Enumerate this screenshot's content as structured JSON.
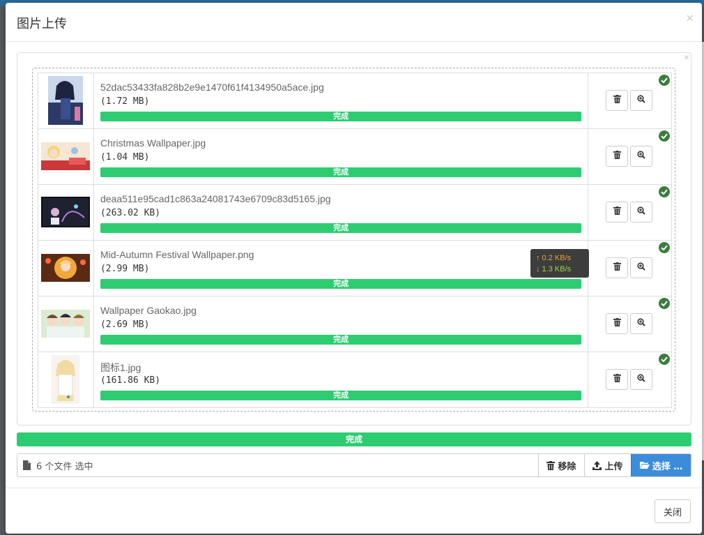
{
  "modal": {
    "title": "图片上传"
  },
  "files": [
    {
      "name": "52dac53433fa828b2e9e1470f61f4134950a5ace.jpg",
      "size": "(1.72 MB)",
      "status": "完成",
      "progress": 1.0
    },
    {
      "name": "Christmas Wallpaper.jpg",
      "size": "(1.04 MB)",
      "status": "完成",
      "progress": 1.0
    },
    {
      "name": "deaa511e95cad1c863a24081743e6709c83d5165.jpg",
      "size": "(263.02 KB)",
      "status": "完成",
      "progress": 1.0
    },
    {
      "name": "Mid-Autumn Festival Wallpaper.png",
      "size": "(2.99 MB)",
      "status": "完成",
      "progress": 1.0
    },
    {
      "name": "Wallpaper Gaokao.jpg",
      "size": "(2.69 MB)",
      "status": "完成",
      "progress": 1.0
    },
    {
      "name": "图标1.jpg",
      "size": "(161.86 KB)",
      "status": "完成",
      "progress": 1.0
    }
  ],
  "speed_tooltip": {
    "upload": "↑ 0.2 KB/s",
    "download": "↓ 1.3 KB/s"
  },
  "total_progress": {
    "label": "完成",
    "value": 1.0
  },
  "caption": {
    "text": "6 个文件 选中"
  },
  "buttons": {
    "remove": "移除",
    "upload": "上传",
    "browse": "选择 …",
    "close": "关闭"
  },
  "colors": {
    "progress": "#2ecc71",
    "browse": "#3c8dd9",
    "check": "#3c7d3f"
  }
}
